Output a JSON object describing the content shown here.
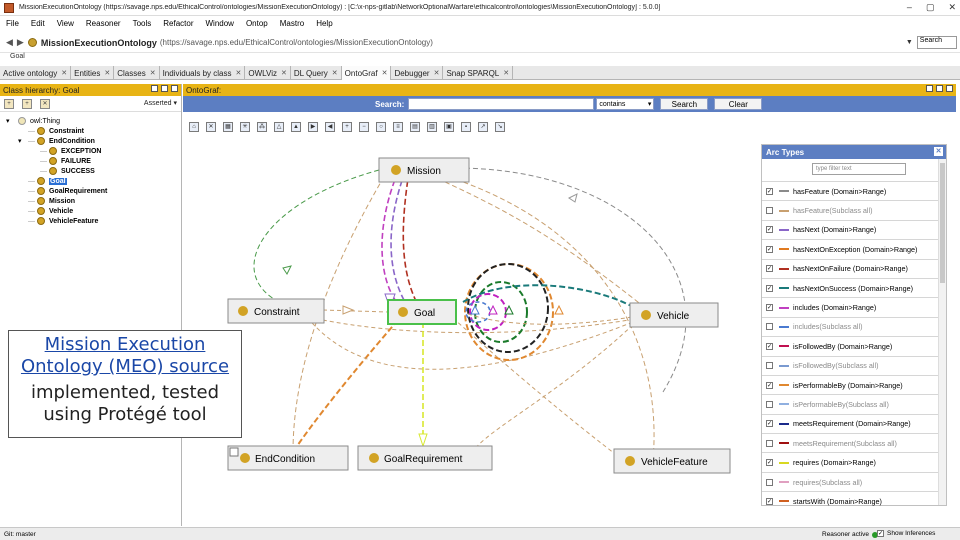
{
  "window": {
    "title": "MissionExecutionOntology (https://savage.nps.edu/EthicalControl/ontologies/MissionExecutionOntology) : [C:\\x-nps-gitlab\\NetworkOptionalWarfare\\ethicalcontrol\\ontologies\\MissionExecutionOntology] : 5.0.0]",
    "controls": [
      "–",
      "▢",
      "✕"
    ]
  },
  "menu": [
    "File",
    "Edit",
    "View",
    "Reasoner",
    "Tools",
    "Refactor",
    "Window",
    "Ontop",
    "Mastro",
    "Help"
  ],
  "address": {
    "name": "MissionExecutionOntology",
    "iri": "(https://savage.nps.edu/EthicalControl/ontologies/MissionExecutionOntology)",
    "search_label": "Search"
  },
  "breadcrumb": "Goal",
  "tabs": [
    {
      "label": "Active ontology",
      "active": false
    },
    {
      "label": "Entities",
      "active": false
    },
    {
      "label": "Classes",
      "active": false
    },
    {
      "label": "Individuals by class",
      "active": false
    },
    {
      "label": "OWLViz",
      "active": false
    },
    {
      "label": "DL Query",
      "active": false
    },
    {
      "label": "OntoGraf",
      "active": true
    },
    {
      "label": "Debugger",
      "active": false
    },
    {
      "label": "Snap SPARQL",
      "active": false
    }
  ],
  "left_pane": {
    "header": "Class hierarchy: Goal",
    "mode": "Asserted",
    "tree": [
      {
        "label": "owl:Thing",
        "level": 0,
        "toggle": "▾",
        "bold": false,
        "light": true
      },
      {
        "label": "Constraint",
        "level": 1,
        "toggle": "",
        "bold": true
      },
      {
        "label": "EndCondition",
        "level": 1,
        "toggle": "▾",
        "bold": true
      },
      {
        "label": "EXCEPTION",
        "level": 2,
        "toggle": "",
        "bold": true
      },
      {
        "label": "FAILURE",
        "level": 2,
        "toggle": "",
        "bold": true
      },
      {
        "label": "SUCCESS",
        "level": 2,
        "toggle": "",
        "bold": true
      },
      {
        "label": "Goal",
        "level": 1,
        "toggle": "",
        "bold": true,
        "selected": true
      },
      {
        "label": "GoalRequirement",
        "level": 1,
        "toggle": "",
        "bold": true
      },
      {
        "label": "Mission",
        "level": 1,
        "toggle": "",
        "bold": true
      },
      {
        "label": "Vehicle",
        "level": 1,
        "toggle": "",
        "bold": true
      },
      {
        "label": "VehicleFeature",
        "level": 1,
        "toggle": "",
        "bold": true
      }
    ]
  },
  "overlay": {
    "line1": "Mission Execution Ontology (MEO) source",
    "line2": "implemented, tested using Protégé tool"
  },
  "ontograf": {
    "header": "OntoGraf:",
    "search_label": "Search:",
    "match_mode": "contains",
    "search_button": "Search",
    "clear_button": "Clear",
    "nodes": [
      {
        "id": "mission",
        "label": "Mission"
      },
      {
        "id": "constraint",
        "label": "Constraint"
      },
      {
        "id": "goal",
        "label": "Goal"
      },
      {
        "id": "vehicle",
        "label": "Vehicle"
      },
      {
        "id": "endcondition",
        "label": "EndCondition"
      },
      {
        "id": "goalrequirement",
        "label": "GoalRequirement"
      },
      {
        "id": "vehiclefeature",
        "label": "VehicleFeature"
      }
    ]
  },
  "arc_types": {
    "header": "Arc Types",
    "filter_placeholder": "type filter text",
    "items": [
      {
        "label": "hasFeature (Domain>Range)",
        "checked": true,
        "color": "#8a8a8a"
      },
      {
        "label": "hasFeature(Subclass all)",
        "checked": false,
        "color": "#c8a070"
      },
      {
        "label": "hasNext (Domain>Range)",
        "checked": true,
        "color": "#8a66c8"
      },
      {
        "label": "hasNextOnException (Domain>Range)",
        "checked": true,
        "color": "#e07a20"
      },
      {
        "label": "hasNextOnFailure (Domain>Range)",
        "checked": true,
        "color": "#b03020"
      },
      {
        "label": "hasNextOnSuccess (Domain>Range)",
        "checked": true,
        "color": "#1a7a7a"
      },
      {
        "label": "includes (Domain>Range)",
        "checked": true,
        "color": "#c040c0"
      },
      {
        "label": "includes(Subclass all)",
        "checked": false,
        "color": "#4a7ad0"
      },
      {
        "label": "isFollowedBy (Domain>Range)",
        "checked": true,
        "color": "#c01050"
      },
      {
        "label": "isFollowedBy(Subclass all)",
        "checked": false,
        "color": "#7a9ad0"
      },
      {
        "label": "isPerformableBy (Domain>Range)",
        "checked": true,
        "color": "#e08830"
      },
      {
        "label": "isPerformableBy(Subclass all)",
        "checked": false,
        "color": "#90b0e0"
      },
      {
        "label": "meetsRequirement (Domain>Range)",
        "checked": true,
        "color": "#1a2a8a"
      },
      {
        "label": "meetsRequirement(Subclass all)",
        "checked": false,
        "color": "#a01010"
      },
      {
        "label": "requires (Domain>Range)",
        "checked": true,
        "color": "#d8d820"
      },
      {
        "label": "requires(Subclass all)",
        "checked": false,
        "color": "#e0a0c0"
      },
      {
        "label": "startsWith (Domain>Range)",
        "checked": true,
        "color": "#d06020"
      }
    ]
  },
  "status": {
    "git": "Git: master",
    "reasoner": "Reasoner active",
    "show_inferences": "Show Inferences"
  }
}
